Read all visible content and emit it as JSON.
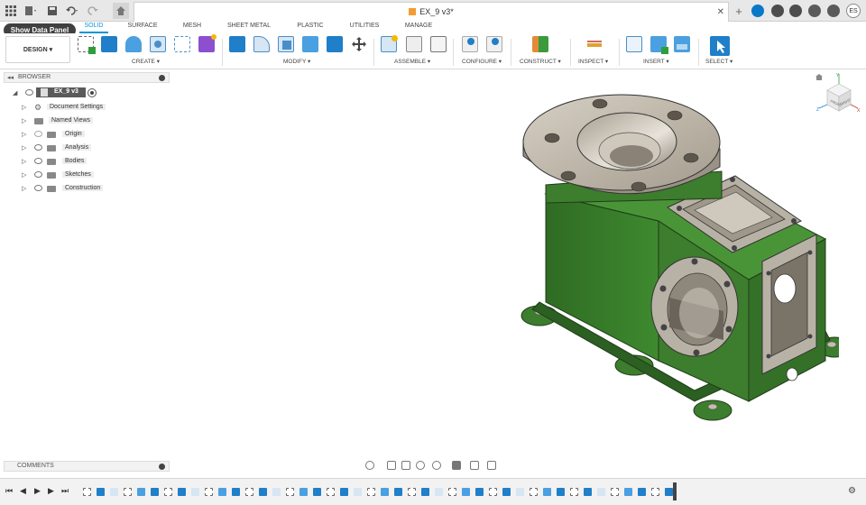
{
  "document": {
    "title": "EX_9 v3*"
  },
  "header": {
    "show_data_panel_label": "Show Data Panel",
    "user_initials": "ES"
  },
  "workspace": {
    "label": "DESIGN ▾"
  },
  "tabs": [
    {
      "label": "SOLID",
      "active": true
    },
    {
      "label": "SURFACE"
    },
    {
      "label": "MESH"
    },
    {
      "label": "SHEET METAL"
    },
    {
      "label": "PLASTIC"
    },
    {
      "label": "UTILITIES"
    },
    {
      "label": "MANAGE"
    }
  ],
  "toolbar_groups": {
    "create": "CREATE ▾",
    "modify": "MODIFY ▾",
    "assemble": "ASSEMBLE ▾",
    "configure": "CONFIGURE ▾",
    "construct": "CONSTRUCT ▾",
    "inspect": "INSPECT ▾",
    "insert": "INSERT ▾",
    "select": "SELECT ▾"
  },
  "browser": {
    "title": "BROWSER",
    "root": "EX_9 v3",
    "items": [
      {
        "label": "Document Settings",
        "icon": "gear-icon"
      },
      {
        "label": "Named Views",
        "icon": "folder-icon"
      },
      {
        "label": "Origin",
        "icon": "folder-icon"
      },
      {
        "label": "Analysis",
        "icon": "folder-icon"
      },
      {
        "label": "Bodies",
        "icon": "folder-icon"
      },
      {
        "label": "Sketches",
        "icon": "folder-icon"
      },
      {
        "label": "Construction",
        "icon": "folder-icon"
      }
    ]
  },
  "comments": {
    "title": "COMMENTS"
  },
  "viewcube": {
    "front_label": "FRONT",
    "right_label": "RIGHT",
    "axis_z": "Z",
    "axis_x": "X",
    "axis_y": "Y"
  },
  "colors": {
    "accent": "#0696d7",
    "model_green": "#3d7d2e",
    "model_metal": "#b8b2a6"
  }
}
